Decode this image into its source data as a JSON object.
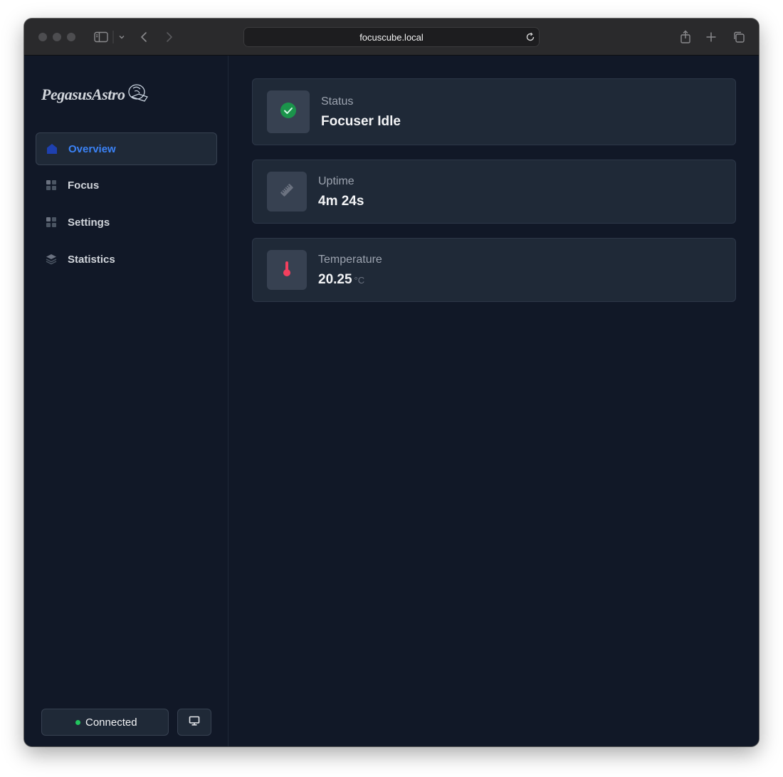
{
  "browser": {
    "url": "focuscube.local"
  },
  "sidebar": {
    "logo": "PegasusAstro",
    "items": [
      {
        "label": "Overview",
        "icon": "home-icon",
        "active": true
      },
      {
        "label": "Focus",
        "icon": "grid-icon",
        "active": false
      },
      {
        "label": "Settings",
        "icon": "grid-icon",
        "active": false
      },
      {
        "label": "Statistics",
        "icon": "layers-icon",
        "active": false
      }
    ],
    "connection": {
      "label": "Connected",
      "status_color": "#22c55e"
    },
    "display_button_icon": "monitor-icon"
  },
  "cards": {
    "status": {
      "label": "Status",
      "value": "Focuser Idle",
      "icon": "check-circle-icon",
      "color": "#22c55e"
    },
    "uptime": {
      "label": "Uptime",
      "value": "4m 24s",
      "icon": "ruler-icon"
    },
    "temperature": {
      "label": "Temperature",
      "value": "20.25",
      "unit": "°C",
      "icon": "thermometer-icon",
      "color": "#f43f5e"
    }
  },
  "colors": {
    "accent": "#3b82f6",
    "background": "#111827",
    "card": "#1f2937"
  }
}
